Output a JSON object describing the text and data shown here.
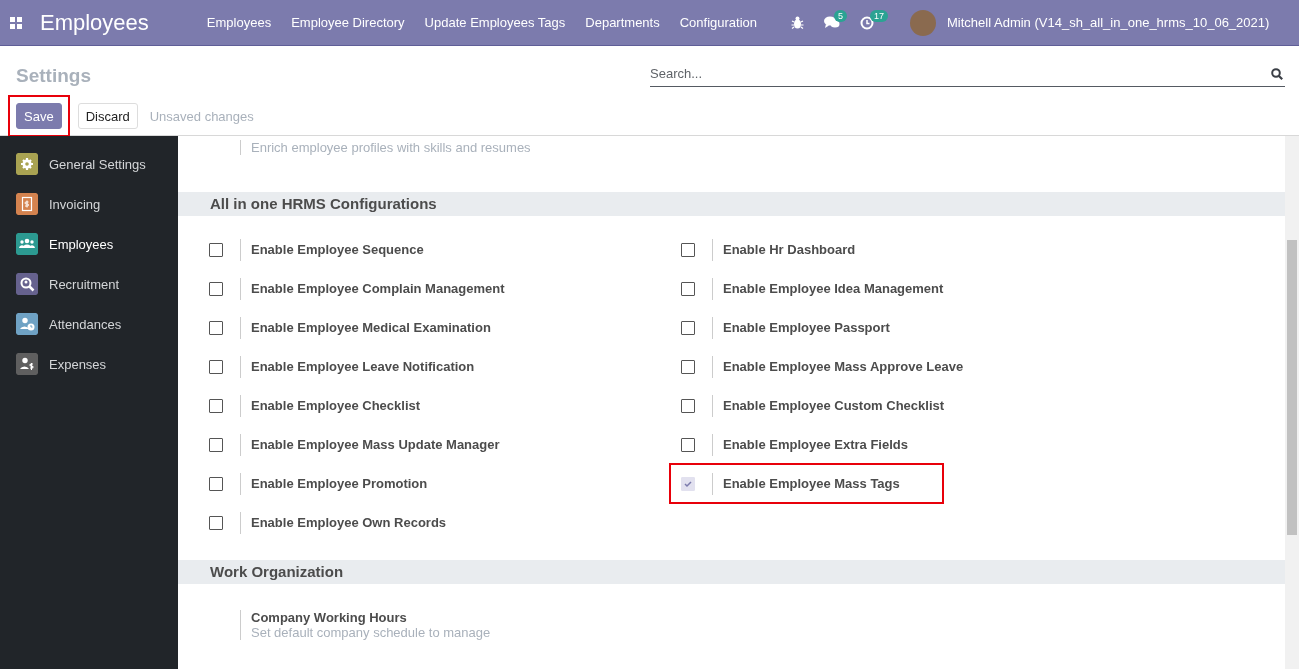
{
  "navbar": {
    "app_title": "Employees",
    "menu": [
      "Employees",
      "Employee Directory",
      "Update Employees Tags",
      "Departments",
      "Configuration"
    ],
    "messages_count": "5",
    "activities_count": "17",
    "user": "Mitchell Admin (V14_sh_all_in_one_hrms_10_06_2021)"
  },
  "control_panel": {
    "title": "Settings",
    "search": {
      "placeholder": "Search..."
    },
    "buttons": [
      {
        "label": "Save",
        "kind": "primary",
        "highlighted": true
      },
      {
        "label": "Discard",
        "kind": "secondary",
        "highlighted": false
      }
    ],
    "status": "Unsaved changes"
  },
  "sidebar": {
    "items": [
      {
        "label": "General Settings",
        "selected": false,
        "color": "#a9a352"
      },
      {
        "label": "Invoicing",
        "selected": false,
        "color": "#d4834f"
      },
      {
        "label": "Employees",
        "selected": true,
        "color": "#2c9a91"
      },
      {
        "label": "Recruitment",
        "selected": false,
        "color": "#66628e"
      },
      {
        "label": "Attendances",
        "selected": false,
        "color": "#6fa2c4"
      },
      {
        "label": "Expenses",
        "selected": false,
        "color": "#5f5f5f"
      }
    ]
  },
  "sections": [
    {
      "kind": "partial",
      "description": "Enrich employee profiles with skills and resumes"
    },
    {
      "kind": "options",
      "title": "All in one HRMS Configurations",
      "options": [
        {
          "label": "Enable Employee Sequence",
          "checked": false,
          "highlighted": false
        },
        {
          "label": "Enable Hr Dashboard",
          "checked": false,
          "highlighted": false
        },
        {
          "label": "Enable Employee Complain Management",
          "checked": false,
          "highlighted": false
        },
        {
          "label": "Enable Employee Idea Management",
          "checked": false,
          "highlighted": false
        },
        {
          "label": "Enable Employee Medical Examination",
          "checked": false,
          "highlighted": false
        },
        {
          "label": "Enable Employee Passport",
          "checked": false,
          "highlighted": false
        },
        {
          "label": "Enable Employee Leave Notification",
          "checked": false,
          "highlighted": false
        },
        {
          "label": "Enable Employee Mass Approve Leave",
          "checked": false,
          "highlighted": false
        },
        {
          "label": "Enable Employee Checklist",
          "checked": false,
          "highlighted": false
        },
        {
          "label": "Enable Employee Custom Checklist",
          "checked": false,
          "highlighted": false
        },
        {
          "label": "Enable Employee Mass Update Manager",
          "checked": false,
          "highlighted": false
        },
        {
          "label": "Enable Employee Extra Fields",
          "checked": false,
          "highlighted": false
        },
        {
          "label": "Enable Employee Promotion",
          "checked": false,
          "highlighted": false
        },
        {
          "label": "Enable Employee Mass Tags",
          "checked": true,
          "highlighted": true
        },
        {
          "label": "Enable Employee Own Records",
          "checked": false,
          "highlighted": false
        }
      ]
    },
    {
      "kind": "settings",
      "title": "Work Organization",
      "settings": [
        {
          "title": "Company Working Hours",
          "description": "Set default company schedule to manage"
        }
      ]
    }
  ]
}
